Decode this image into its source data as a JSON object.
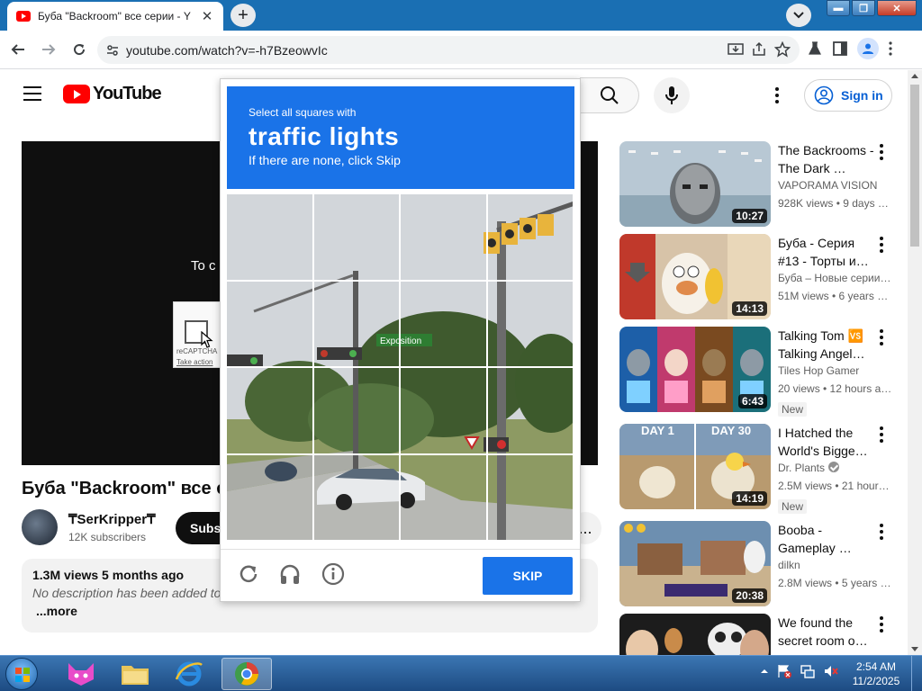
{
  "browser": {
    "tab_title": "Буба \"Backroom\" все серии - Y",
    "tab_close": "✕",
    "new_tab": "+",
    "url": "youtube.com/watch?v=-h7BzeowvIc"
  },
  "youtube": {
    "logo_text": "YouTube",
    "sign_in": "Sign in"
  },
  "player": {
    "overlay_text": "To c",
    "recaptcha_label": "reCAPTCHA",
    "recaptcha_action": "Take action"
  },
  "video": {
    "title": "Буба \"Backroom\" все сер",
    "channel": "₸SerKripper₸",
    "subscribers": "12K subscribers",
    "subscribe": "Subs",
    "more": "...",
    "views_age": "1.3M views  5 months ago",
    "description": "No description has been added to",
    "more_link": "...more"
  },
  "recommendations": [
    {
      "title": "The Backrooms - The Dark …",
      "channel": "VAPORAMA VISION",
      "stats": "928K views • 9 days …",
      "duration": "10:27",
      "new": ""
    },
    {
      "title": "Буба - Серия #13 - Торты и…",
      "channel": "Буба – Новые серии…",
      "stats": "51M views • 6 years …",
      "duration": "14:13",
      "new": ""
    },
    {
      "title": "Talking Tom 🆚 Talking Angel…",
      "channel": "Tiles Hop Gamer",
      "stats": "20 views • 12 hours a…",
      "duration": "6:43",
      "new": "New"
    },
    {
      "title": "I Hatched the World's Bigge…",
      "channel": "Dr. Plants",
      "stats": "2.5M views • 21 hour…",
      "duration": "14:19",
      "new": "New",
      "thumb_left": "DAY 1",
      "thumb_right": "DAY 30"
    },
    {
      "title": "Booba - Gameplay …",
      "channel": "dilkn",
      "stats": "2.8M views • 5 years …",
      "duration": "20:38",
      "new": ""
    },
    {
      "title": "We found the secret room o…",
      "channel": "",
      "stats": "",
      "duration": "",
      "new": ""
    }
  ],
  "captcha": {
    "line1": "Select all squares with",
    "line2": "traffic lights",
    "line3": "If there are none, click Skip",
    "sign_text": "Exposition",
    "skip": "SKIP",
    "colors": {
      "header": "#1a73e8"
    }
  },
  "taskbar": {
    "time": "2:54 AM",
    "date": "11/2/2025"
  }
}
